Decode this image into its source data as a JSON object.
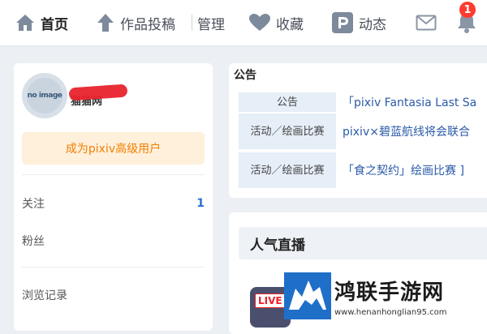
{
  "nav": {
    "home": "首页",
    "submit": "作品投稿",
    "manage": "管理",
    "bookmarks": "收藏",
    "feed": "动态",
    "notification_count": "1"
  },
  "sidebar": {
    "avatar_text": "no image",
    "username": "猫猫网",
    "premium_button": "成为pixiv高级用户",
    "following_label": "关注",
    "following_count": "1",
    "followers_label": "粉丝",
    "history_label": "浏览记录"
  },
  "notice": {
    "title": "公告",
    "rows": [
      {
        "tag": "公告",
        "text": "「pixiv Fantasia Last Sa"
      },
      {
        "tag": "活动／绘画比赛",
        "text": "pixiv×碧蓝航线将会联合"
      },
      {
        "tag": "活动／绘画比赛",
        "text": "「食之契约」绘画比赛 ]"
      }
    ]
  },
  "live": {
    "title": "人气直播",
    "badge": "LIVE"
  },
  "watermark": {
    "text": "鸿联手游网",
    "url": "www.henanhonglian95.com"
  },
  "colors": {
    "accent_orange": "#f08000",
    "premium_bg": "#fff0dc",
    "link_blue": "#2a5aa8",
    "notification_red": "#ff3b30",
    "watermark_blue": "#1f6fc9"
  }
}
